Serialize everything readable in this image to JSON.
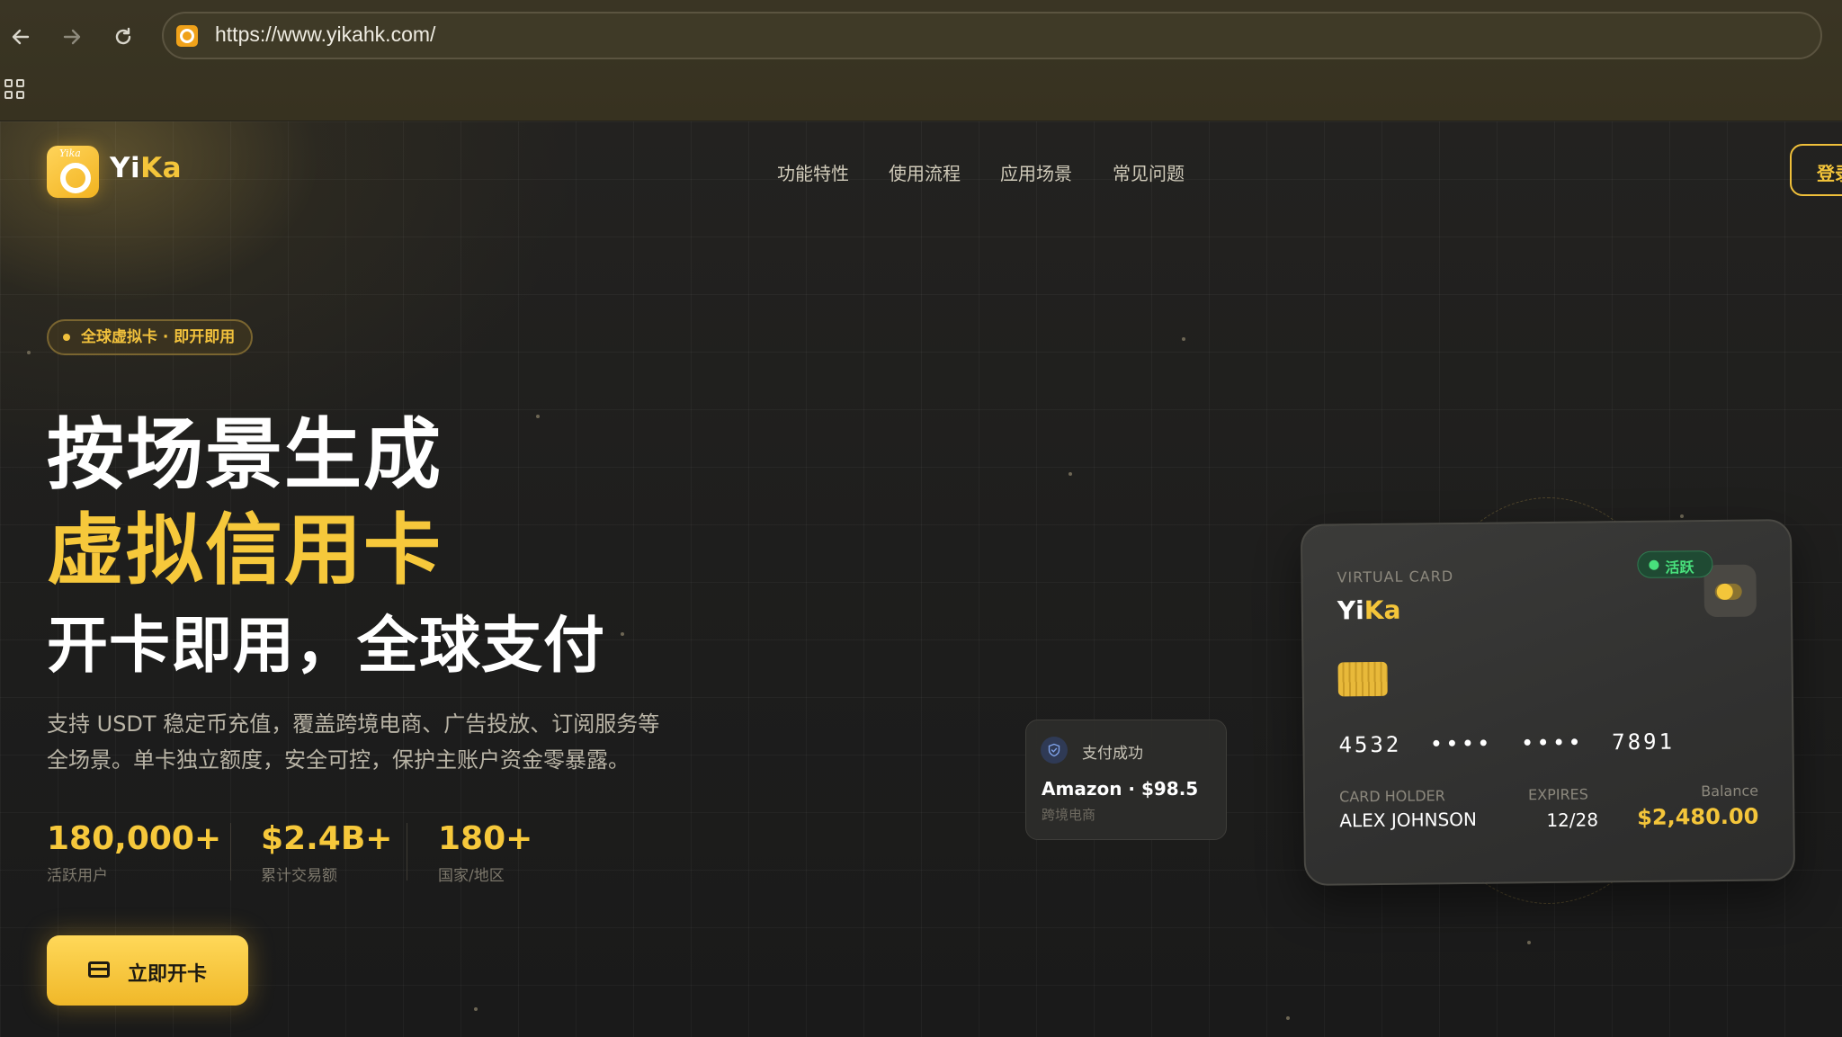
{
  "browser": {
    "url": "https://www.yikahk.com/",
    "back_icon": "arrow-left-icon",
    "forward_icon": "arrow-right-icon",
    "reload_icon": "reload-icon",
    "apps_icon": "apps-grid-icon"
  },
  "header": {
    "brand_prefix": "Yi",
    "brand_suffix": "Ka",
    "logo_text": "Yika",
    "nav": [
      "功能特性",
      "使用流程",
      "应用场景",
      "常见问题"
    ],
    "login_label": "登录"
  },
  "hero": {
    "badge": "全球虚拟卡 · 即开即用",
    "title_line1": "按场景生成",
    "title_line2": "虚拟信用卡",
    "subtitle": "开卡即用，全球支付",
    "desc_line1": "支持 USDT 稳定币充值，覆盖跨境电商、广告投放、订阅服务等",
    "desc_line2": "全场景。单卡独立额度，安全可控，保护主账户资金零暴露。",
    "stats": [
      {
        "value": "180,000+",
        "label": "活跃用户"
      },
      {
        "value": "$2.4B+",
        "label": "累计交易额"
      },
      {
        "value": "180+",
        "label": "国家/地区"
      }
    ],
    "cta_label": "立即开卡",
    "cta_icon": "credit-card-icon"
  },
  "toast": {
    "icon": "shield-check-icon",
    "title": "支付成功",
    "amount": "Amazon · $98.5",
    "category": "跨境电商"
  },
  "card": {
    "label": "VIRTUAL CARD",
    "brand_prefix": "Yi",
    "brand_suffix": "Ka",
    "status": "活跃",
    "number": "4532 •••• •••• 7891",
    "holder_label": "CARD HOLDER",
    "holder": "ALEX JOHNSON",
    "expires_label": "EXPIRES",
    "expires": "12/28",
    "balance_label": "Balance",
    "balance": "$2,480.00"
  },
  "colors": {
    "accent": "#f4c53a",
    "status_green": "#48e07c",
    "background": "#1b1b1a"
  }
}
